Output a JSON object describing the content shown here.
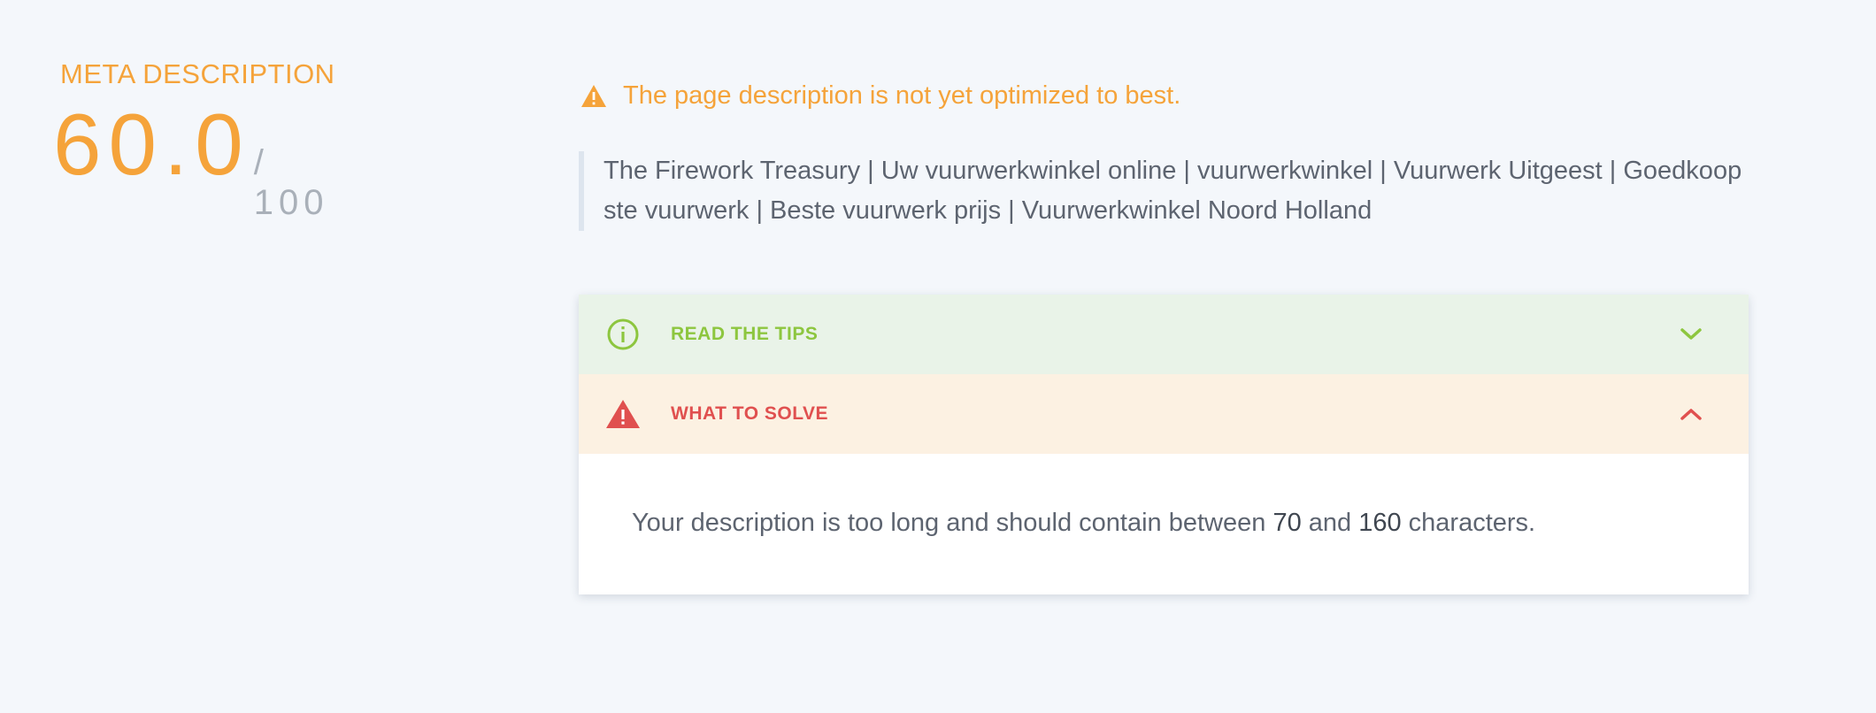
{
  "score": {
    "title": "META DESCRIPTION",
    "value": "60.0",
    "max": "/ 100"
  },
  "status": {
    "icon": "warning-triangle-icon",
    "message": "The page description is not yet optimized to best."
  },
  "description": {
    "text": "The Firework Treasury | Uw vuurwerkwinkel online | vuurwerkwinkel | Vuurwerk Uitgeest | Goedkoopste vuurwerk | Beste vuurwerk prijs | Vuurwerkwinkel Noord Holland"
  },
  "accordion": {
    "tips": {
      "label": "READ THE TIPS",
      "icon": "info-circle-icon",
      "expanded": false
    },
    "solve": {
      "label": "WHAT TO SOLVE",
      "icon": "warning-triangle-icon",
      "expanded": true,
      "body": {
        "prefix": "Your description is too long and should contain between ",
        "min": "70",
        "middle": " and ",
        "max": "160",
        "suffix": " characters."
      }
    }
  },
  "colors": {
    "accent_orange": "#f5a33a",
    "success_green": "#8dc63f",
    "error_red": "#e0504f",
    "tips_bg": "#e9f3e8",
    "solve_bg": "#fcf1e2",
    "page_bg": "#f4f7fb"
  }
}
